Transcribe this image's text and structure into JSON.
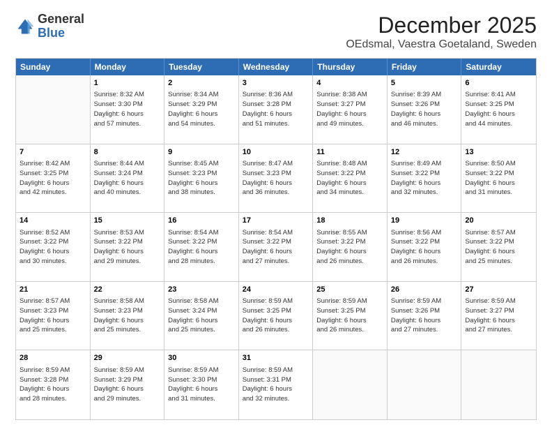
{
  "header": {
    "logo_general": "General",
    "logo_blue": "Blue",
    "month_title": "December 2025",
    "subtitle": "OEdsmal, Vaestra Goetaland, Sweden"
  },
  "days": [
    "Sunday",
    "Monday",
    "Tuesday",
    "Wednesday",
    "Thursday",
    "Friday",
    "Saturday"
  ],
  "weeks": [
    [
      {
        "day": "",
        "info": ""
      },
      {
        "day": "1",
        "info": "Sunrise: 8:32 AM\nSunset: 3:30 PM\nDaylight: 6 hours\nand 57 minutes."
      },
      {
        "day": "2",
        "info": "Sunrise: 8:34 AM\nSunset: 3:29 PM\nDaylight: 6 hours\nand 54 minutes."
      },
      {
        "day": "3",
        "info": "Sunrise: 8:36 AM\nSunset: 3:28 PM\nDaylight: 6 hours\nand 51 minutes."
      },
      {
        "day": "4",
        "info": "Sunrise: 8:38 AM\nSunset: 3:27 PM\nDaylight: 6 hours\nand 49 minutes."
      },
      {
        "day": "5",
        "info": "Sunrise: 8:39 AM\nSunset: 3:26 PM\nDaylight: 6 hours\nand 46 minutes."
      },
      {
        "day": "6",
        "info": "Sunrise: 8:41 AM\nSunset: 3:25 PM\nDaylight: 6 hours\nand 44 minutes."
      }
    ],
    [
      {
        "day": "7",
        "info": "Sunrise: 8:42 AM\nSunset: 3:25 PM\nDaylight: 6 hours\nand 42 minutes."
      },
      {
        "day": "8",
        "info": "Sunrise: 8:44 AM\nSunset: 3:24 PM\nDaylight: 6 hours\nand 40 minutes."
      },
      {
        "day": "9",
        "info": "Sunrise: 8:45 AM\nSunset: 3:23 PM\nDaylight: 6 hours\nand 38 minutes."
      },
      {
        "day": "10",
        "info": "Sunrise: 8:47 AM\nSunset: 3:23 PM\nDaylight: 6 hours\nand 36 minutes."
      },
      {
        "day": "11",
        "info": "Sunrise: 8:48 AM\nSunset: 3:22 PM\nDaylight: 6 hours\nand 34 minutes."
      },
      {
        "day": "12",
        "info": "Sunrise: 8:49 AM\nSunset: 3:22 PM\nDaylight: 6 hours\nand 32 minutes."
      },
      {
        "day": "13",
        "info": "Sunrise: 8:50 AM\nSunset: 3:22 PM\nDaylight: 6 hours\nand 31 minutes."
      }
    ],
    [
      {
        "day": "14",
        "info": "Sunrise: 8:52 AM\nSunset: 3:22 PM\nDaylight: 6 hours\nand 30 minutes."
      },
      {
        "day": "15",
        "info": "Sunrise: 8:53 AM\nSunset: 3:22 PM\nDaylight: 6 hours\nand 29 minutes."
      },
      {
        "day": "16",
        "info": "Sunrise: 8:54 AM\nSunset: 3:22 PM\nDaylight: 6 hours\nand 28 minutes."
      },
      {
        "day": "17",
        "info": "Sunrise: 8:54 AM\nSunset: 3:22 PM\nDaylight: 6 hours\nand 27 minutes."
      },
      {
        "day": "18",
        "info": "Sunrise: 8:55 AM\nSunset: 3:22 PM\nDaylight: 6 hours\nand 26 minutes."
      },
      {
        "day": "19",
        "info": "Sunrise: 8:56 AM\nSunset: 3:22 PM\nDaylight: 6 hours\nand 26 minutes."
      },
      {
        "day": "20",
        "info": "Sunrise: 8:57 AM\nSunset: 3:22 PM\nDaylight: 6 hours\nand 25 minutes."
      }
    ],
    [
      {
        "day": "21",
        "info": "Sunrise: 8:57 AM\nSunset: 3:23 PM\nDaylight: 6 hours\nand 25 minutes."
      },
      {
        "day": "22",
        "info": "Sunrise: 8:58 AM\nSunset: 3:23 PM\nDaylight: 6 hours\nand 25 minutes."
      },
      {
        "day": "23",
        "info": "Sunrise: 8:58 AM\nSunset: 3:24 PM\nDaylight: 6 hours\nand 25 minutes."
      },
      {
        "day": "24",
        "info": "Sunrise: 8:59 AM\nSunset: 3:25 PM\nDaylight: 6 hours\nand 26 minutes."
      },
      {
        "day": "25",
        "info": "Sunrise: 8:59 AM\nSunset: 3:25 PM\nDaylight: 6 hours\nand 26 minutes."
      },
      {
        "day": "26",
        "info": "Sunrise: 8:59 AM\nSunset: 3:26 PM\nDaylight: 6 hours\nand 27 minutes."
      },
      {
        "day": "27",
        "info": "Sunrise: 8:59 AM\nSunset: 3:27 PM\nDaylight: 6 hours\nand 27 minutes."
      }
    ],
    [
      {
        "day": "28",
        "info": "Sunrise: 8:59 AM\nSunset: 3:28 PM\nDaylight: 6 hours\nand 28 minutes."
      },
      {
        "day": "29",
        "info": "Sunrise: 8:59 AM\nSunset: 3:29 PM\nDaylight: 6 hours\nand 29 minutes."
      },
      {
        "day": "30",
        "info": "Sunrise: 8:59 AM\nSunset: 3:30 PM\nDaylight: 6 hours\nand 31 minutes."
      },
      {
        "day": "31",
        "info": "Sunrise: 8:59 AM\nSunset: 3:31 PM\nDaylight: 6 hours\nand 32 minutes."
      },
      {
        "day": "",
        "info": ""
      },
      {
        "day": "",
        "info": ""
      },
      {
        "day": "",
        "info": ""
      }
    ]
  ]
}
